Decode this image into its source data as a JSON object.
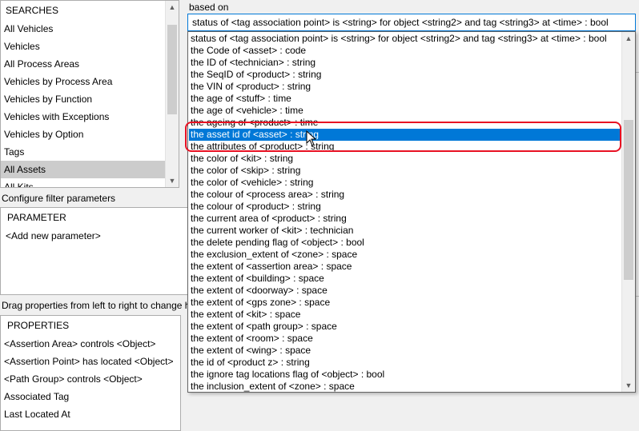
{
  "searches": {
    "header": "SEARCHES",
    "items": [
      "All Vehicles",
      "Vehicles",
      "All Process Areas",
      "Vehicles by Process Area",
      "Vehicles by Function",
      "Vehicles with Exceptions",
      "Vehicles by Option",
      "Tags",
      "All Assets",
      "All Kits"
    ],
    "selected_index": 8
  },
  "filter": {
    "label": "Configure filter parameters",
    "header": "PARAMETER",
    "add": "<Add new parameter>"
  },
  "properties": {
    "label": "Drag properties from left to right to change h",
    "header": "PROPERTIES",
    "items": [
      "<Assertion Area> controls <Object>",
      "<Assertion Point> has located <Object>",
      "<Path Group> controls <Object>",
      "Associated Tag",
      "Last Located At"
    ]
  },
  "based_on": {
    "label": "based on",
    "value": "status of <tag association point> is <string> for object <string2> and tag <string3> at <time> : bool",
    "options": [
      "status of <tag association point> is <string> for object <string2> and tag <string3> at <time> : bool",
      "the Code of <asset> : code",
      "the ID of <technician> : string",
      "the SeqID of <product> : string",
      "the VIN of <product> : string",
      "the age of <stuff> : time",
      "the age of <vehicle> : time",
      "the ageing of <product> : time",
      "the asset id of <asset> : string",
      "the attributes of <product> : string",
      "the color of <kit> : string",
      "the color of <skip> : string",
      "the color of <vehicle> : string",
      "the colour of <process area> : string",
      "the colour of <product> : string",
      "the current area of <product> : string",
      "the current worker of <kit> : technician",
      "the delete pending flag of <object> : bool",
      "the exclusion_extent of <zone> : space",
      "the extent of <assertion area> : space",
      "the extent of <building> : space",
      "the extent of <doorway> : space",
      "the extent of <gps zone> : space",
      "the extent of <kit> : space",
      "the extent of <path group> : space",
      "the extent of <room> : space",
      "the extent of <wing> : space",
      "the id of <product z> : string",
      "the ignore tag locations flag of <object> : bool",
      "the inclusion_extent of <zone> : space"
    ],
    "highlighted_index": 8
  },
  "colors": {
    "selection": "#0078d7",
    "highlight_ring": "#e81123"
  }
}
